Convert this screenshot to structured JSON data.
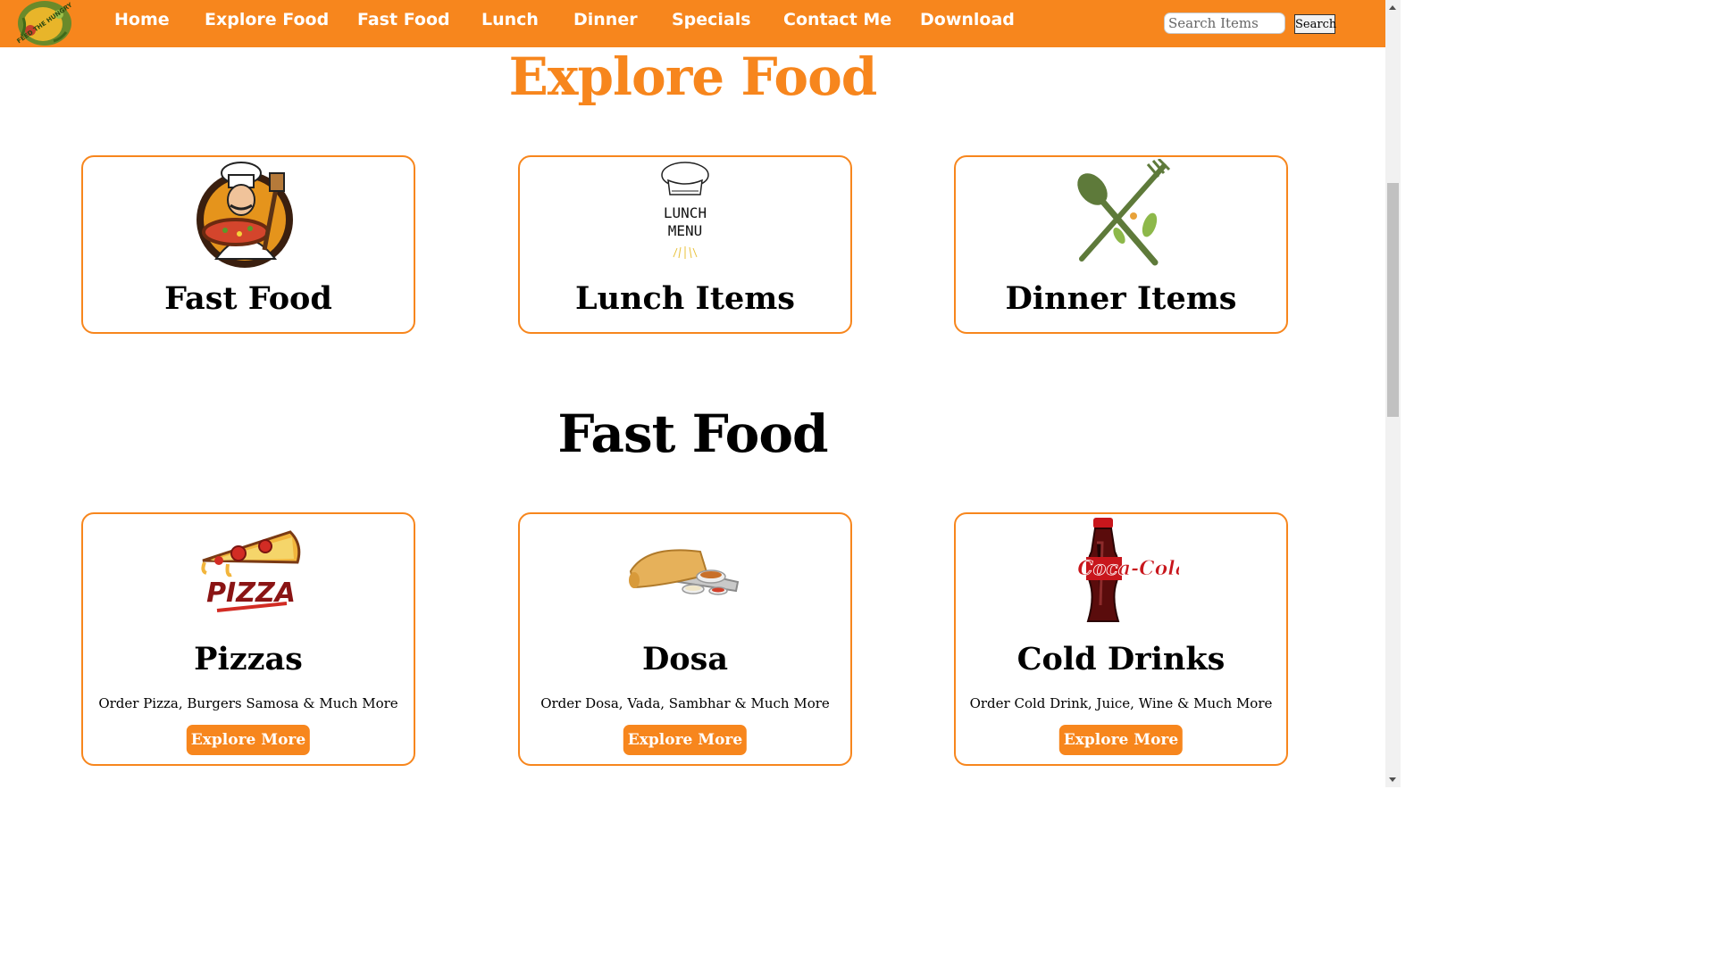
{
  "colors": {
    "brand_orange": "#f7861d",
    "white": "#ffffff",
    "black": "#000000"
  },
  "navbar": {
    "logo_icon": "feed-the-hungry-logo",
    "logo_text": "FEED THE HUNGRY",
    "links": [
      "Home",
      "Explore Food",
      "Fast Food",
      "Lunch",
      "Dinner",
      "Specials",
      "Contact Me",
      "Download"
    ],
    "search_placeholder": "Search Items",
    "search_button": "Search"
  },
  "explore_section": {
    "title": "Explore Food",
    "cards": [
      {
        "title": "Fast Food",
        "icon": "chef-pizza-icon"
      },
      {
        "title": "Lunch Items",
        "icon": "lunch-menu-icon",
        "icon_text_1": "LUNCH",
        "icon_text_2": "MENU"
      },
      {
        "title": "Dinner Items",
        "icon": "spoon-fork-icon"
      }
    ]
  },
  "fastfood_section": {
    "title": "Fast Food",
    "cards": [
      {
        "title": "Pizzas",
        "icon": "pizza-slice-icon",
        "icon_text": "PIZZA",
        "description": "Order Pizza, Burgers Samosa & Much More",
        "button": "Explore More"
      },
      {
        "title": "Dosa",
        "icon": "dosa-plate-icon",
        "description": "Order Dosa, Vada, Sambhar & Much More",
        "button": "Explore More"
      },
      {
        "title": "Cold Drinks",
        "icon": "coca-cola-bottle-icon",
        "icon_text": "Coca-Cola",
        "description": "Order Cold Drink, Juice, Wine & Much More",
        "button": "Explore More"
      }
    ]
  }
}
